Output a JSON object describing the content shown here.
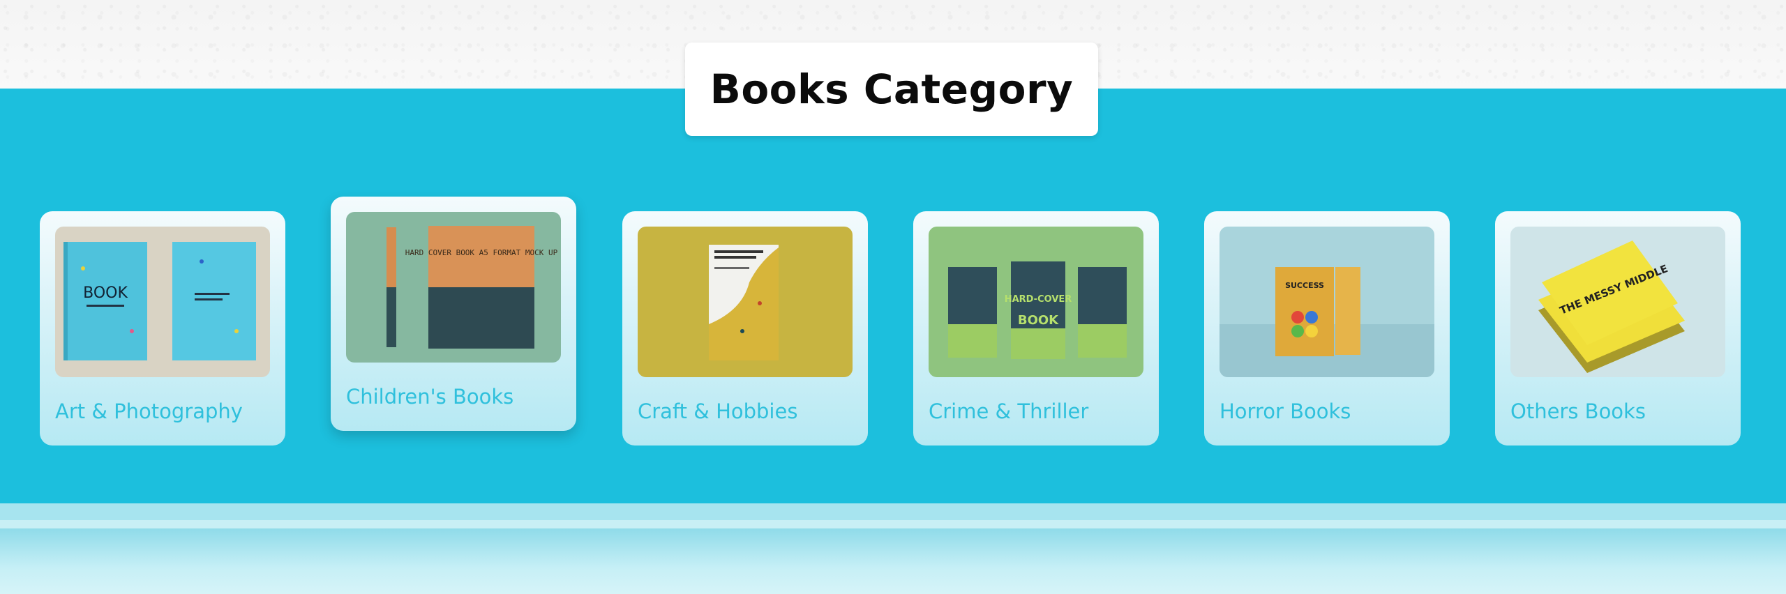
{
  "header": {
    "title": "Books Category"
  },
  "categories": [
    {
      "label": "Art & Photography",
      "thumb_text_left": "BOOK"
    },
    {
      "label": "Children's Books",
      "thumb_text": "HARD COVER BOOK A5 FORMAT MOCK UP"
    },
    {
      "label": "Craft & Hobbies"
    },
    {
      "label": "Crime & Thriller",
      "thumb_text_1": "HARD-COVER",
      "thumb_text_2": "BOOK"
    },
    {
      "label": "Horror Books",
      "thumb_text": "SUCCESS"
    },
    {
      "label": "Others Books",
      "thumb_text": "THE MESSY MIDDLE"
    }
  ],
  "colors": {
    "band": "#1cbfdd",
    "label": "#2fc0dc",
    "title": "#0b0b0b"
  }
}
